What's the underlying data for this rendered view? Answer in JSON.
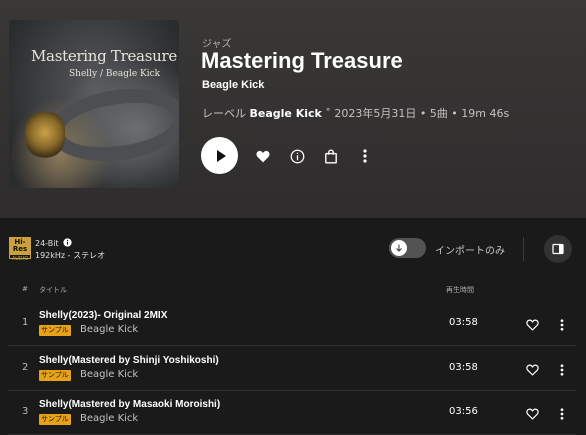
{
  "album": {
    "cover": {
      "title_line1": "Mastering Treasure",
      "title_line2": "Shelly / Beagle Kick"
    },
    "genre": "ジャズ",
    "title": "Mastering Treasure",
    "artist": "Beagle Kick",
    "meta": {
      "label_prefix": "レーベル",
      "label_name": "Beagle Kick",
      "rest": " ˚ 2023年5月31日 • 5曲 • 19m 46s"
    }
  },
  "actions": {
    "play": "play-icon",
    "favorite": "heart-icon",
    "info": "info-icon",
    "purchase": "bag-icon",
    "more": "more-vertical-icon"
  },
  "quality": {
    "badge_top": "Hi-Res",
    "badge_bottom": "AUDIO",
    "bit_depth": "24-Bit",
    "sample_rate": "192kHz - ステレオ"
  },
  "toggle": {
    "label": "インポートのみ",
    "enabled": false
  },
  "columns": {
    "number": "#",
    "title": "タイトル",
    "duration": "再生時間"
  },
  "tracks": [
    {
      "number": "1",
      "title": "Shelly(2023)- Original 2MIX",
      "badge": "サンプル",
      "artist": "Beagle Kick",
      "duration": "03:58"
    },
    {
      "number": "2",
      "title": "Shelly(Mastered by Shinji Yoshikoshi)",
      "badge": "サンプル",
      "artist": "Beagle Kick",
      "duration": "03:58"
    },
    {
      "number": "3",
      "title": "Shelly(Mastered by Masaoki Moroishi)",
      "badge": "サンプル",
      "artist": "Beagle Kick",
      "duration": "03:56"
    }
  ],
  "colors": {
    "sample_badge": "#e8a218",
    "hires_gold": "#caa13a",
    "background": "#1a1a1a"
  }
}
